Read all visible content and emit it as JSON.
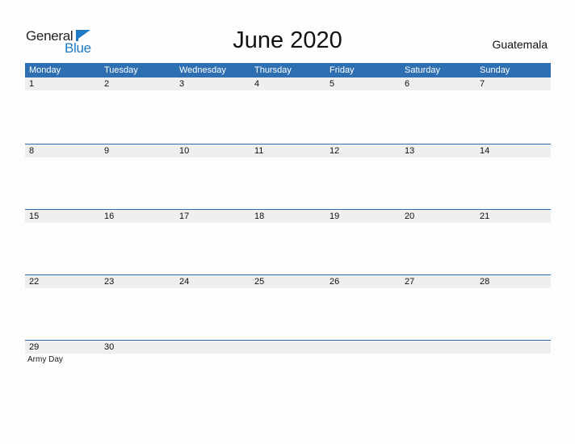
{
  "logo": {
    "general": "General",
    "blue": "Blue",
    "icon": "triangle-flag-icon",
    "accent": "#1f7ac6"
  },
  "title": "June 2020",
  "country": "Guatemala",
  "header_color": "#2e6fb2",
  "weekdays": [
    "Monday",
    "Tuesday",
    "Wednesday",
    "Thursday",
    "Friday",
    "Saturday",
    "Sunday"
  ],
  "weeks": [
    {
      "dates": [
        "1",
        "2",
        "3",
        "4",
        "5",
        "6",
        "7"
      ],
      "events": [
        "",
        "",
        "",
        "",
        "",
        "",
        ""
      ]
    },
    {
      "dates": [
        "8",
        "9",
        "10",
        "11",
        "12",
        "13",
        "14"
      ],
      "events": [
        "",
        "",
        "",
        "",
        "",
        "",
        ""
      ]
    },
    {
      "dates": [
        "15",
        "16",
        "17",
        "18",
        "19",
        "20",
        "21"
      ],
      "events": [
        "",
        "",
        "",
        "",
        "",
        "",
        ""
      ]
    },
    {
      "dates": [
        "22",
        "23",
        "24",
        "25",
        "26",
        "27",
        "28"
      ],
      "events": [
        "",
        "",
        "",
        "",
        "",
        "",
        ""
      ]
    },
    {
      "dates": [
        "29",
        "30",
        "",
        "",
        "",
        "",
        ""
      ],
      "events": [
        "Army Day",
        "",
        "",
        "",
        "",
        "",
        ""
      ]
    }
  ]
}
